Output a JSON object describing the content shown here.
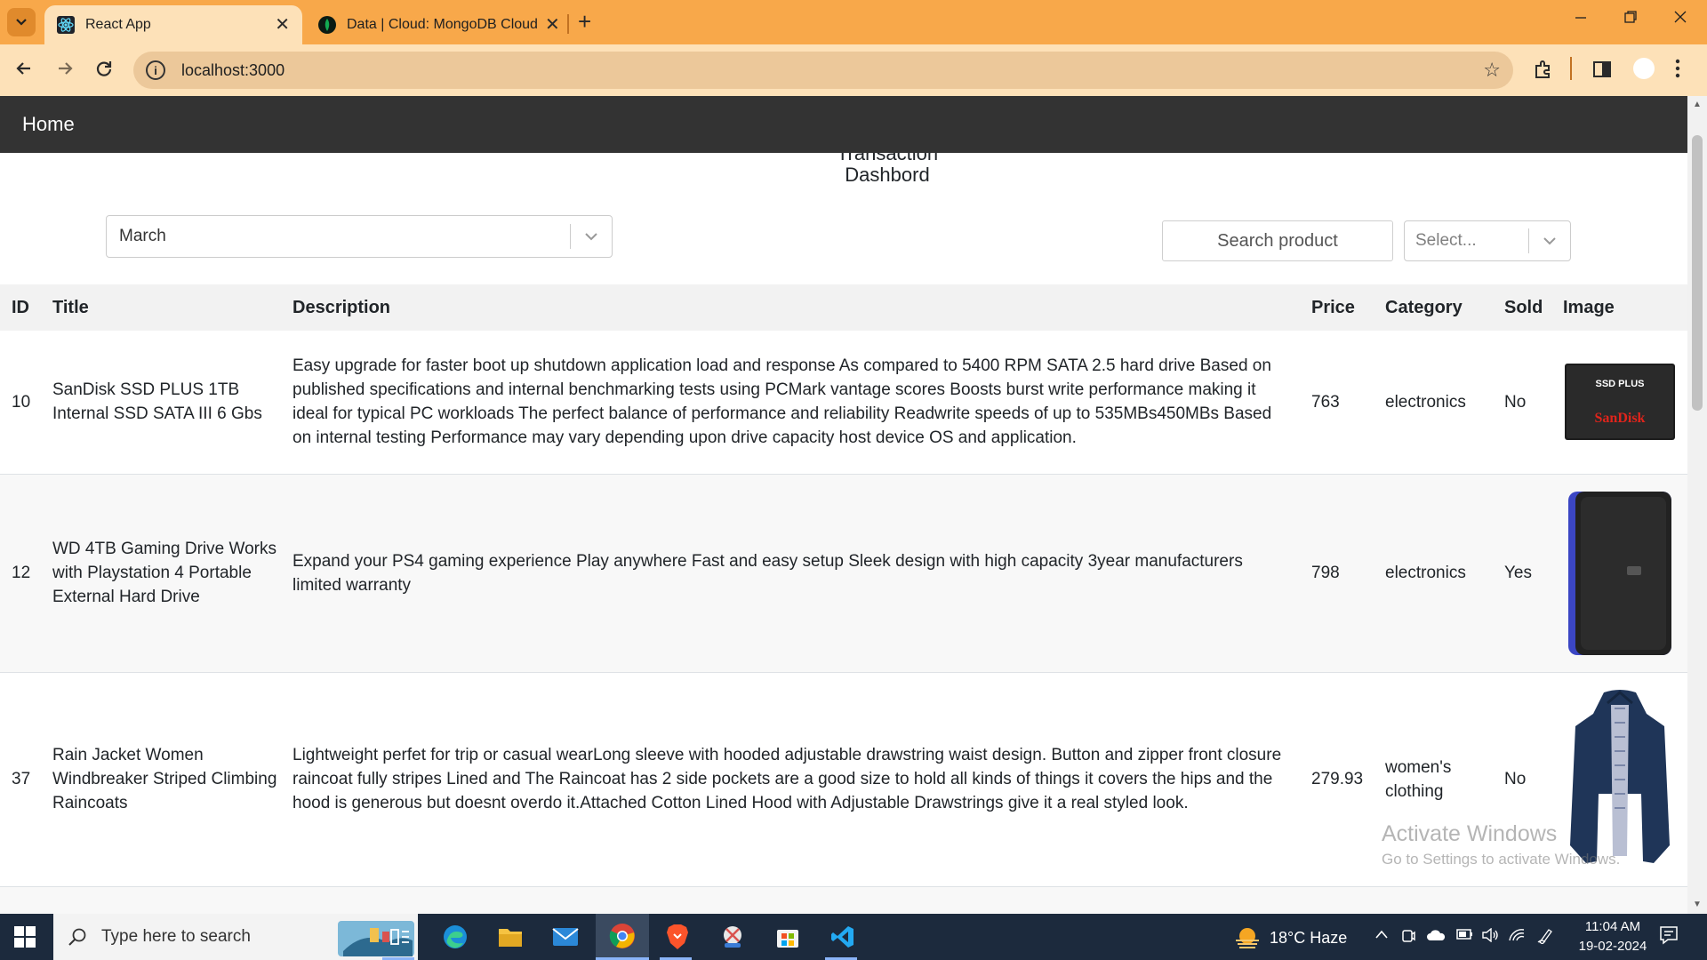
{
  "browser": {
    "tabs": [
      {
        "title": "React App",
        "favicon": "react-icon",
        "active": true
      },
      {
        "title": "Data | Cloud: MongoDB Cloud",
        "favicon": "mongodb-leaf-icon",
        "active": false
      }
    ],
    "new_tab": "+",
    "url": "localhost:3000",
    "accent": "#f8a84a"
  },
  "page": {
    "nav_home": "Home",
    "title_partial": "Transaction",
    "title": "Dashbord",
    "month_select": {
      "value": "March"
    },
    "search": {
      "placeholder": "Search product"
    },
    "category_select": {
      "placeholder": "Select..."
    },
    "table": {
      "headers": {
        "id": "ID",
        "title": "Title",
        "description": "Description",
        "price": "Price",
        "category": "Category",
        "sold": "Sold",
        "image": "Image"
      },
      "rows": [
        {
          "id": "10",
          "title": "SanDisk SSD PLUS 1TB Internal SSD SATA III 6 Gbs",
          "description": "Easy upgrade for faster boot up shutdown application load and response As compared to 5400 RPM SATA 2.5 hard drive Based on published specifications and internal benchmarking tests using PCMark vantage scores Boosts burst write performance making it ideal for typical PC workloads The perfect balance of performance and reliability Readwrite speeds of up to 535MBs450MBs Based on internal testing Performance may vary depending upon drive capacity host device OS and application.",
          "price": "763",
          "category": "electronics",
          "sold": "No",
          "image_label": "SSD PLUS",
          "image_brand": "SanDisk"
        },
        {
          "id": "12",
          "title": "WD 4TB Gaming Drive Works with Playstation 4 Portable External Hard Drive",
          "description": "Expand your PS4 gaming experience Play anywhere Fast and easy setup Sleek design with high capacity 3year manufacturers limited warranty",
          "price": "798",
          "category": "electronics",
          "sold": "Yes"
        },
        {
          "id": "37",
          "title": "Rain Jacket Women Windbreaker Striped Climbing Raincoats",
          "description": "Lightweight perfet for trip or casual wearLong sleeve with hooded adjustable drawstring waist design. Button and zipper front closure raincoat fully stripes Lined and The Raincoat has 2 side pockets are a good size to hold all kinds of things it covers the hips and the hood is generous but doesnt overdo it.Attached Cotton Lined Hood with Adjustable Drawstrings give it a real styled look.",
          "price": "279.93",
          "category": "women's clothing",
          "sold": "No"
        }
      ]
    },
    "watermark": {
      "line1": "Activate Windows",
      "line2": "Go to Settings to activate Windows."
    }
  },
  "taskbar": {
    "search_placeholder": "Type here to search",
    "weather": "18°C  Haze",
    "time": "11:04 AM",
    "date": "19-02-2024"
  }
}
